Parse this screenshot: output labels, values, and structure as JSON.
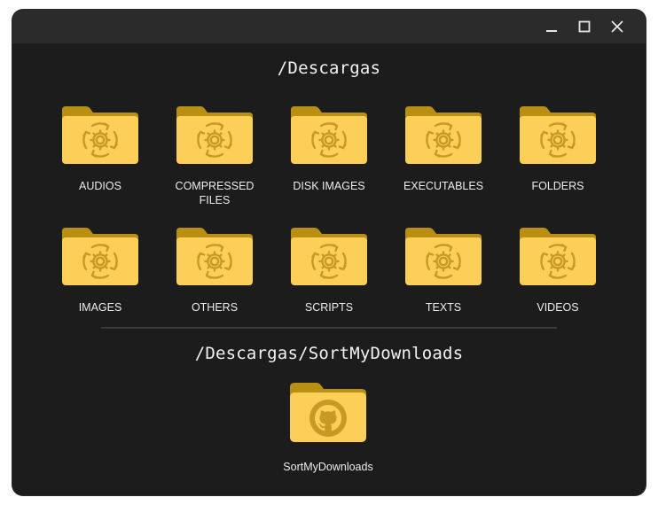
{
  "window": {
    "controls": {
      "minimize_icon": "minimize-icon",
      "maximize_icon": "maximize-icon",
      "close_icon": "close-icon"
    }
  },
  "main": {
    "path": "/Descargas",
    "folders": [
      {
        "label": "AUDIOS",
        "icon": "folder-sort-icon"
      },
      {
        "label": "COMPRESSED\nFILES",
        "icon": "folder-sort-icon"
      },
      {
        "label": "DISK IMAGES",
        "icon": "folder-sort-icon"
      },
      {
        "label": "EXECUTABLES",
        "icon": "folder-sort-icon"
      },
      {
        "label": "FOLDERS",
        "icon": "folder-sort-icon"
      },
      {
        "label": "IMAGES",
        "icon": "folder-sort-icon"
      },
      {
        "label": "OTHERS",
        "icon": "folder-sort-icon"
      },
      {
        "label": "SCRIPTS",
        "icon": "folder-sort-icon"
      },
      {
        "label": "TEXTS",
        "icon": "folder-sort-icon"
      },
      {
        "label": "VIDEOS",
        "icon": "folder-sort-icon"
      }
    ]
  },
  "app": {
    "path": "/Descargas/SortMyDownloads",
    "folder": {
      "label": "SortMyDownloads",
      "icon": "folder-github-icon"
    }
  },
  "colors": {
    "window_bg": "#1c1c1c",
    "titlebar_bg": "#2b2b2b",
    "folder_front": "#fcd058",
    "folder_back": "#b98f12",
    "folder_glyph": "#c79b22"
  }
}
